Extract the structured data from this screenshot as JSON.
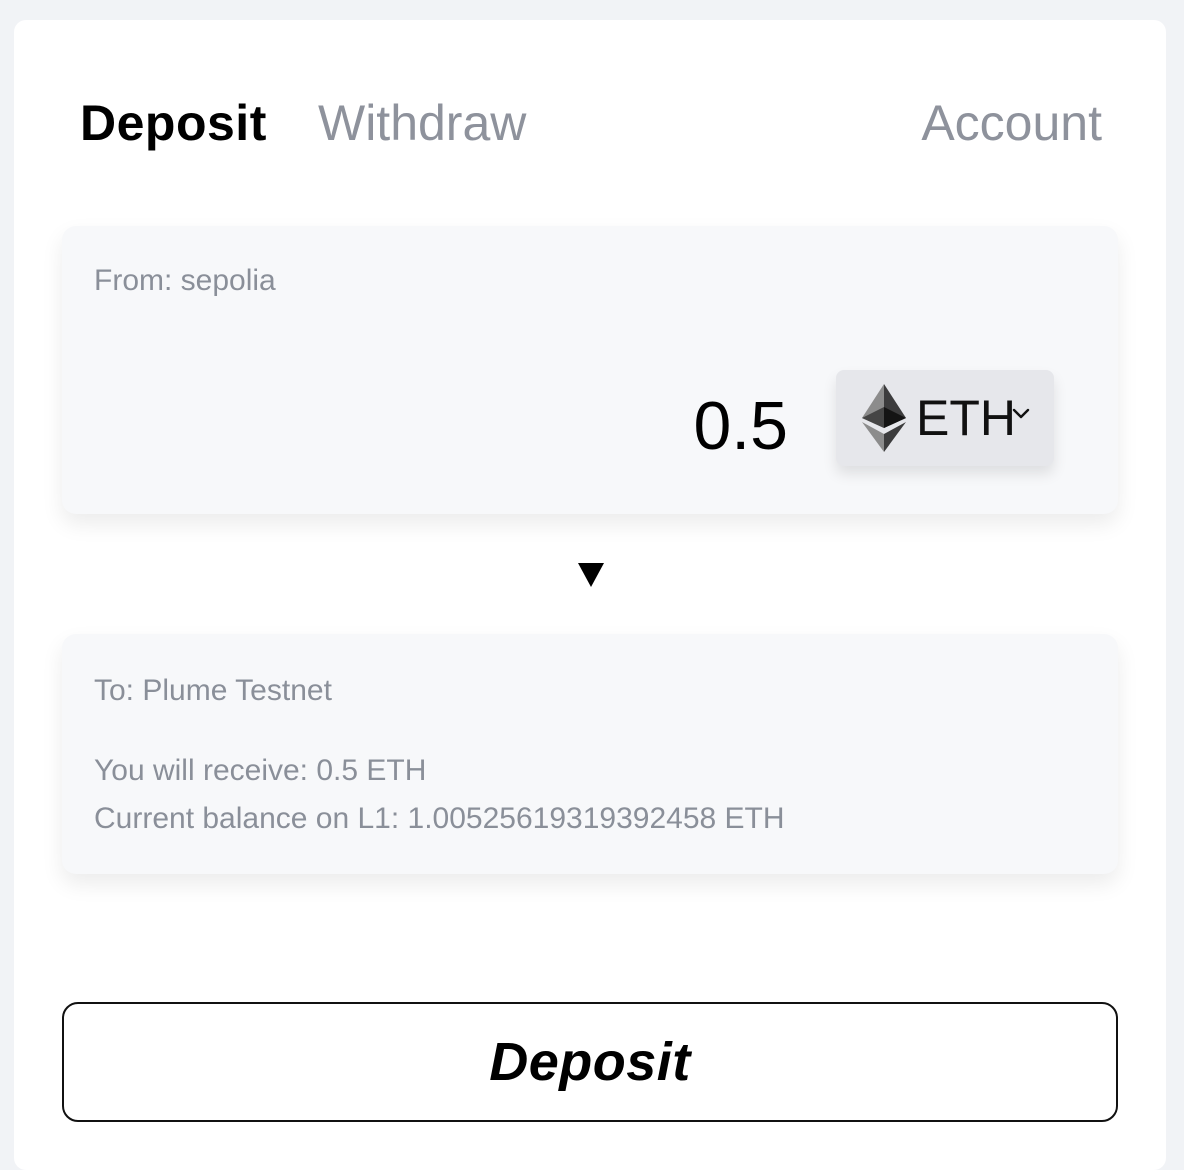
{
  "tabs": {
    "deposit": "Deposit",
    "withdraw": "Withdraw",
    "account": "Account"
  },
  "from_panel": {
    "label": "From: sepolia",
    "amount": "0.5",
    "token": {
      "symbol": "ETH",
      "icon": "ethereum-icon",
      "dropdown_icon": "chevron-down-icon"
    }
  },
  "direction_icon": "arrow-down-icon",
  "to_panel": {
    "label": "To: Plume Testnet",
    "receive": "You will receive: 0.5 ETH",
    "balance": "Current balance on L1: 1.00525619319392458 ETH"
  },
  "deposit_button": "Deposit",
  "colors": {
    "active_tab": "#000000",
    "inactive_tab": "#8e929c",
    "panel_bg": "#f7f8fa",
    "token_select_bg": "#e6e7eb",
    "muted_text": "#8a8f99"
  }
}
